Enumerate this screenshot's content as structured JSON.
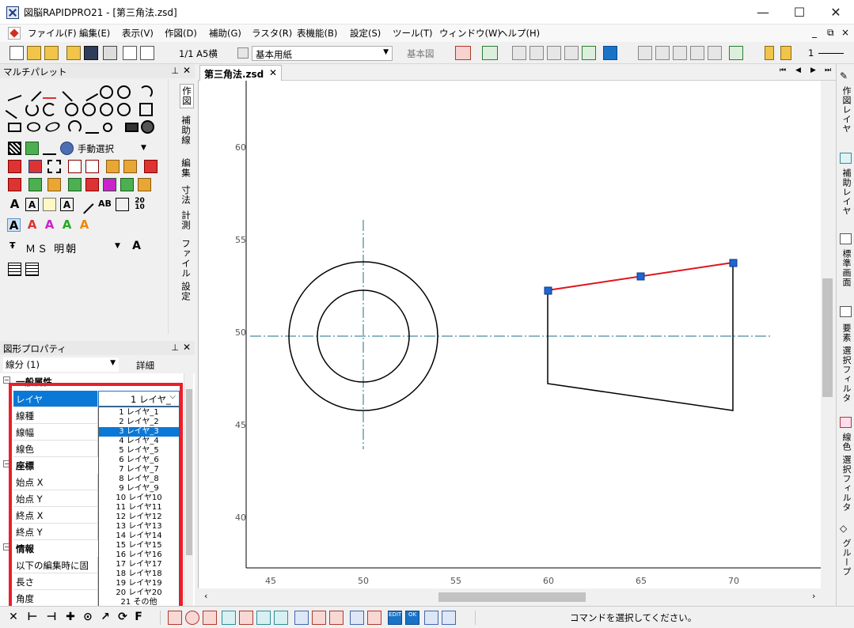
{
  "window": {
    "title": "図脳RAPIDPRO21 - [第三角法.zsd]",
    "minimize": "—",
    "maximize": "☐",
    "close": "✕"
  },
  "menu": {
    "items": [
      "ファイル(F)",
      "編集(E)",
      "表示(V)",
      "作図(D)",
      "補助(G)",
      "ラスタ(R)",
      "表機能(B)",
      "設定(S)",
      "ツール(T)",
      "ウィンドウ(W)",
      "ヘルプ(H)"
    ],
    "mdi_min": "_",
    "mdi_restore": "⧉",
    "mdi_close": "×"
  },
  "toolbar": {
    "page_info": "1/1 A5横",
    "paper_select": "基本用紙",
    "base_view": "基本図",
    "line_width": "1"
  },
  "multi_palette": {
    "title": "マルチパレット",
    "pin": "⊥",
    "close": "✕",
    "select_mode": "手動選択",
    "font_name": "ＭＳ 明朝",
    "tabs": [
      "作図",
      "補助線",
      "編集",
      "寸法",
      "計測",
      "ファイル",
      "設定"
    ]
  },
  "properties": {
    "title": "図形プロパティ",
    "pin": "⊥",
    "close": "✕",
    "object_type": "線分 (1)",
    "detail": "詳細",
    "categories": {
      "general": "一般属性",
      "coords": "座標",
      "info": "情報"
    },
    "rows": {
      "layer": "レイヤ",
      "line_type": "線種",
      "line_width": "線幅",
      "line_color": "線色",
      "start_x": "始点 X",
      "start_y": "始点 Y",
      "end_x": "終点 X",
      "end_y": "終点 Y",
      "fix_on_edit": "以下の編集時に固定",
      "length": "長さ",
      "angle": "角度"
    },
    "layer_value": "1 レイヤ_",
    "layer_options": [
      "1 レイヤ_1",
      "2 レイヤ_2",
      "3 レイヤ_3",
      "4 レイヤ_4",
      "5 レイヤ_5",
      "6 レイヤ_6",
      "7 レイヤ_7",
      "8 レイヤ_8",
      "9 レイヤ_9",
      "10 レイヤ10",
      "11 レイヤ11",
      "12 レイヤ12",
      "13 レイヤ13",
      "14 レイヤ14",
      "15 レイヤ15",
      "16 レイヤ16",
      "17 レイヤ17",
      "18 レイヤ18",
      "19 レイヤ19",
      "20 レイヤ20",
      "21 その他"
    ],
    "selected_option_index": 2
  },
  "document": {
    "tab_title": "第三角法.zsd",
    "tab_close": "✕",
    "x_ticks": [
      "45",
      "50",
      "55",
      "60",
      "65",
      "70"
    ],
    "y_ticks": [
      "60",
      "55",
      "50",
      "45",
      "40"
    ],
    "nav": [
      "⏮",
      "◀",
      "▶",
      "⏭"
    ]
  },
  "right_tabs": [
    "作図レイヤ",
    "補助レイヤ",
    "標準画面",
    "要素 選択フィルタ",
    "線色 選択フィルタ",
    "グループ"
  ],
  "status": {
    "message": "コマンドを選択してください。"
  },
  "colors": {
    "selection_blue": "#0a78d7",
    "highlight_red": "#e8202a",
    "centerline": "#1a6f8a",
    "selected_segment": "#e0151b",
    "handle": "#1e66d0"
  }
}
